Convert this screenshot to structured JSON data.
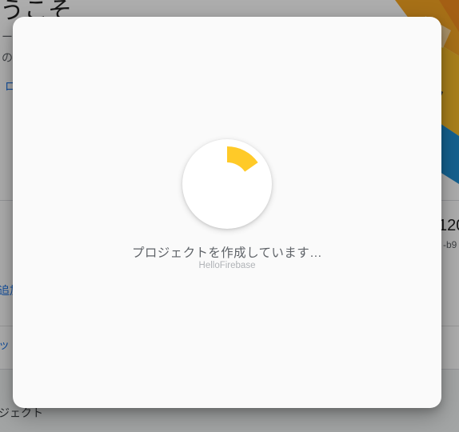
{
  "background": {
    "welcome_heading": "うこそ",
    "intro_line1": "ーサ",
    "intro_line2": "の",
    "link_partial": "ロ",
    "add_link_partial": "追加",
    "text_link_partial": "ット",
    "project_card_title_partial": "120",
    "project_card_id_partial": "-b9",
    "footer_partial": "ジェクト"
  },
  "dialog": {
    "status_text": "プロジェクトを作成しています…",
    "project_name": "HelloFirebase",
    "spinner": {
      "icon": "progress-spinner-icon",
      "color": "#ffca28"
    }
  },
  "colors": {
    "accent_yellow": "#ffca28",
    "link_blue": "#1a73e8",
    "scrim": "rgba(0,0,0,0.32)"
  }
}
